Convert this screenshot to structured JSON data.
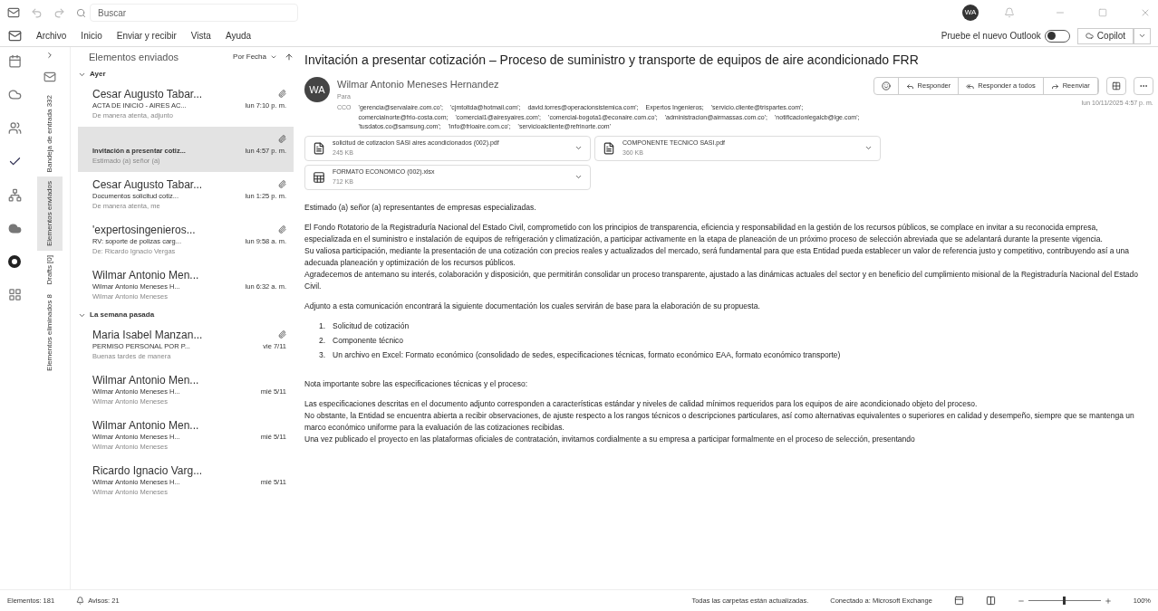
{
  "title_bar": {
    "search_placeholder": "Buscar",
    "avatar": "WA"
  },
  "menu": [
    {
      "label": "Archivo"
    },
    {
      "label": "Inicio"
    },
    {
      "label": "Enviar y recibir"
    },
    {
      "label": "Vista"
    },
    {
      "label": "Ayuda"
    }
  ],
  "new_outlook": {
    "label": "Pruebe el nuevo Outlook",
    "on": false
  },
  "copilot": {
    "label": "Copilot"
  },
  "folders": [
    {
      "label": "Bandeja de entrada 332",
      "selected": false
    },
    {
      "label": "Elementos enviados",
      "selected": true
    },
    {
      "label": "Drafts [0]",
      "selected": false
    },
    {
      "label": "Elementos eliminados 8",
      "selected": false
    }
  ],
  "message_list": {
    "folder": "Elementos enviados",
    "sort": "Por Fecha",
    "groups": [
      {
        "label": "Ayer",
        "items": [
          {
            "sender": "Cesar Augusto Tabar...",
            "subject": "ACTA DE INICIO - AIRES AC...",
            "time": "lun 7:10 p. m.",
            "preview": "De manera atenta, adjunto",
            "attachment": true,
            "selected": false
          },
          {
            "subject": "Invitación a presentar cotiz...",
            "time": "lun 4:57 p. m.",
            "preview": "Estimado (a) señor (a)",
            "attachment": true,
            "selected": true
          },
          {
            "sender": "Cesar Augusto Tabar...",
            "subject": "Documentos solicitud cotiz...",
            "time": "lun 1:25 p. m.",
            "preview": "De manera atenta, me",
            "attachment": true,
            "selected": false
          },
          {
            "sender": "'expertosingenieros...",
            "subject": "RV: soporte de polizas carg...",
            "time": "lun 9:58 a. m.",
            "preview": "De: Ricardo Ignacio Vergas",
            "attachment": true,
            "selected": false
          },
          {
            "sender": "Wilmar Antonio Men...",
            "subject": "Wilmar Antonio Meneses H...",
            "time": "lun 6:32 a. m.",
            "preview": "Wilmar Antonio Meneses",
            "attachment": false,
            "selected": false
          }
        ]
      },
      {
        "label": "La semana pasada",
        "items": [
          {
            "sender": "Maria Isabel Manzan...",
            "subject": "PERMISO PERSONAL POR P...",
            "time": "vie 7/11",
            "preview": "Buenas tardes de manera",
            "attachment": true,
            "selected": false
          },
          {
            "sender": "Wilmar Antonio Men...",
            "subject": "Wilmar Antonio Meneses H...",
            "time": "mié 5/11",
            "preview": "Wilmar Antonio Meneses",
            "attachment": false,
            "selected": false
          },
          {
            "sender": "Wilmar Antonio Men...",
            "subject": "Wilmar Antonio Meneses H...",
            "time": "mié 5/11",
            "preview": "Wilmar Antonio Meneses",
            "attachment": false,
            "selected": false
          },
          {
            "sender": "Ricardo Ignacio Varg...",
            "subject": "Wilmar Antonio Meneses H...",
            "time": "mié 5/11",
            "preview": "Wilmar Antonio Meneses",
            "attachment": false,
            "selected": false
          }
        ]
      }
    ]
  },
  "message": {
    "subject": "Invitación a presentar cotización – Proceso de suministro y transporte de equipos de aire acondicionado FRR",
    "initials": "WA",
    "from": "Wilmar Antonio Meneses Hernandez",
    "to_label": "Para",
    "date": "lun 10/11/2025 4:57 p. m.",
    "actions": [
      {
        "label": "Responder"
      },
      {
        "label": "Responder a todos"
      },
      {
        "label": "Reenviar"
      }
    ],
    "cc_label": "CCO",
    "cc": [
      "'gerencia@servalaire.com.co';",
      "'cjmtoltda@hotmail.com';",
      "david.torres@operacionsistemica.com';",
      "Expertos Ingenieros;",
      "'servicio.cliente@trispartes.com';",
      "comercialnorte@frio-costa.com;",
      "'comercial1@airesyaires.com';",
      "'comercial-bogota1@econaire.com.co';",
      "'administracion@airmassas.com.co';",
      "'notificacionlegalcb@lge.com';",
      "'tusdatos.co@samsung.com';",
      "'info@frioaire.com.co';",
      "'servicioalcliente@refrinorte.com'"
    ],
    "attachments": [
      {
        "kind": "pdf",
        "name": "solicitud de cotizacion SASI aires acondicionados (002).pdf",
        "size": "245 KB"
      },
      {
        "kind": "pdf",
        "name": "COMPONENTE TECNICO SASI.pdf",
        "size": "360 KB"
      },
      {
        "kind": "xlsx",
        "name": "FORMATO ECONOMICO (002).xlsx",
        "size": "712 KB"
      }
    ],
    "body": [
      {
        "kind": "p",
        "text": "Estimado (a) señor (a) representantes de empresas especializadas."
      },
      {
        "kind": "p",
        "text": "El Fondo Rotatorio de la Registraduría Nacional del Estado Civil, comprometido con los principios de transparencia, eficiencia y responsabilidad en la gestión de los recursos públicos, se complace en invitar a su reconocida empresa, especializada en el suministro e instalación de equipos de refrigeración y climatización, a participar activamente en la etapa de planeación de un próximo proceso de selección abreviada que se adelantará durante la presente vigencia."
      },
      {
        "kind": "line",
        "text": "Su valiosa participación, mediante la presentación de una cotización con precios reales y actualizados del mercado, será fundamental para que esta Entidad pueda establecer un valor de referencia justo y competitivo, contribuyendo así a una adecuada planeación y optimización de los recursos públicos."
      },
      {
        "kind": "line",
        "text": "Agradecemos de antemano su interés, colaboración y disposición, que permitirán consolidar un proceso transparente, ajustado a las dinámicas actuales del sector y en beneficio del cumplimiento misional de la Registraduría Nacional del Estado Civil."
      },
      {
        "kind": "p",
        "text": "Adjunto a esta comunicación encontrará la siguiente documentación los cuales servirán de base para la elaboración de su propuesta."
      },
      {
        "kind": "list",
        "items": [
          "Solicitud de cotización",
          "Componente técnico",
          "Un archivo en Excel: Formato económico (consolidado de sedes, especificaciones técnicas, formato económico EAA, formato económico transporte)"
        ],
        "numbers": [
          "1.",
          "2.",
          "3."
        ]
      },
      {
        "kind": "p",
        "text": "Nota importante sobre las especificaciones técnicas y el proceso:"
      },
      {
        "kind": "p",
        "text": "Las especificaciones descritas en el documento adjunto corresponden a características estándar y niveles de calidad mínimos requeridos para los equipos de aire acondicionado objeto del proceso."
      },
      {
        "kind": "line",
        "text": "No obstante, la Entidad se encuentra abierta a recibir observaciones, de ajuste respecto a los rangos técnicos o descripciones particulares, así como alternativas equivalentes o superiores en calidad y desempeño, siempre que se mantenga un marco económico uniforme para la evaluación de las cotizaciones recibidas."
      },
      {
        "kind": "line",
        "text": "Una vez publicado el proyecto en las plataformas oficiales de contratación, invitamos cordialmente a su empresa a participar formalmente en el proceso de selección, presentando"
      }
    ]
  },
  "status_bar": {
    "items": "Elementos: 181",
    "reminders": "Avisos: 21",
    "sync": "Todas las carpetas están actualizadas.",
    "connection": "Conectado a: Microsoft Exchange",
    "zoom": "100%",
    "zoom_level": {
      "level": 0.5
    }
  }
}
